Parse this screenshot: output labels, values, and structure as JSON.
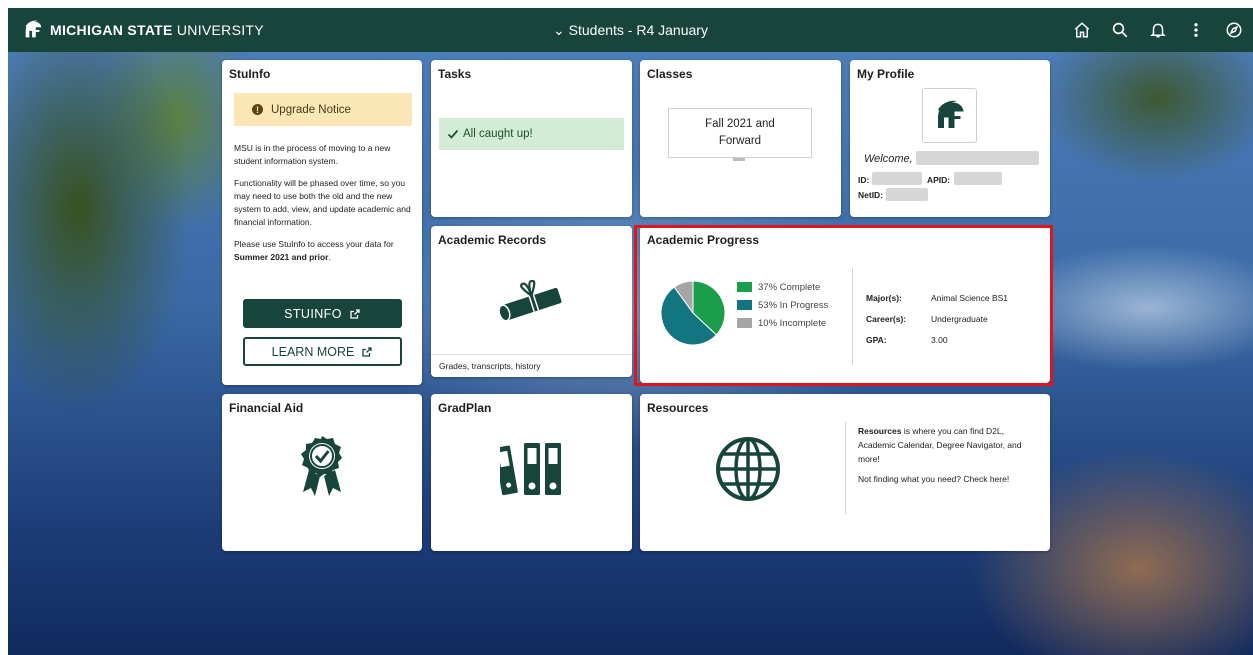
{
  "header": {
    "brand_bold": "MICHIGAN STATE",
    "brand_rest": "UNIVERSITY",
    "title_chevron": "⌄",
    "title": "Students - R4 January",
    "icons": [
      "home-icon",
      "search-icon",
      "bell-icon",
      "more-vertical-icon",
      "compass-icon"
    ]
  },
  "tiles": {
    "stuinfo": {
      "title": "StuInfo",
      "notice": "Upgrade Notice",
      "notice_icon": "!",
      "p1": "MSU is in the process of moving to a new student information system.",
      "p2": "Functionality will be phased over time, so you may need to use both the old and the new system to add, view, and update academic and financial information.",
      "p3_pre": "Please use StuInfo to access your data for ",
      "p3_bold": "Summer 2021 and prior",
      "p3_post": ".",
      "btn_primary": "STUINFO",
      "btn_secondary": "LEARN MORE"
    },
    "tasks": {
      "title": "Tasks",
      "status": "All caught up!"
    },
    "classes": {
      "title": "Classes",
      "term_line1": "Fall 2021 and",
      "term_line2": "Forward"
    },
    "profile": {
      "title": "My Profile",
      "welcome": "Welcome,",
      "id_label": "ID:",
      "apid_label": "APID:",
      "netid_label": "NetID:"
    },
    "records": {
      "title": "Academic Records",
      "footer": "Grades, transcripts, history"
    },
    "progress": {
      "title": "Academic Progress",
      "legend": [
        {
          "label": "37% Complete",
          "color": "#1a9e4b"
        },
        {
          "label": "53% In Progress",
          "color": "#137580"
        },
        {
          "label": "10% Incomplete",
          "color": "#a5a5a5"
        }
      ],
      "major_label": "Major(s):",
      "major_value": "Animal Science BS1",
      "career_label": "Career(s):",
      "career_value": "Undergraduate",
      "gpa_label": "GPA:",
      "gpa_value": "3.00"
    },
    "financial_aid": {
      "title": "Financial Aid"
    },
    "gradplan": {
      "title": "GradPlan"
    },
    "resources": {
      "title": "Resources",
      "p1_bold": "Resources",
      "p1_rest": " is where you can find D2L, Academic Calendar, Degree Navigator, and more!",
      "p2": "Not finding what you need? Check here!"
    }
  },
  "chart_data": {
    "type": "pie",
    "categories": [
      "Complete",
      "In Progress",
      "Incomplete"
    ],
    "values": [
      37,
      53,
      10
    ],
    "colors": [
      "#1a9e4b",
      "#137580",
      "#a5a5a5"
    ]
  },
  "colors": {
    "msu_green": "#18453b",
    "notice_bg": "#fbe6b6",
    "success_bg": "#d3ecd6",
    "highlight": "#e0151b"
  }
}
